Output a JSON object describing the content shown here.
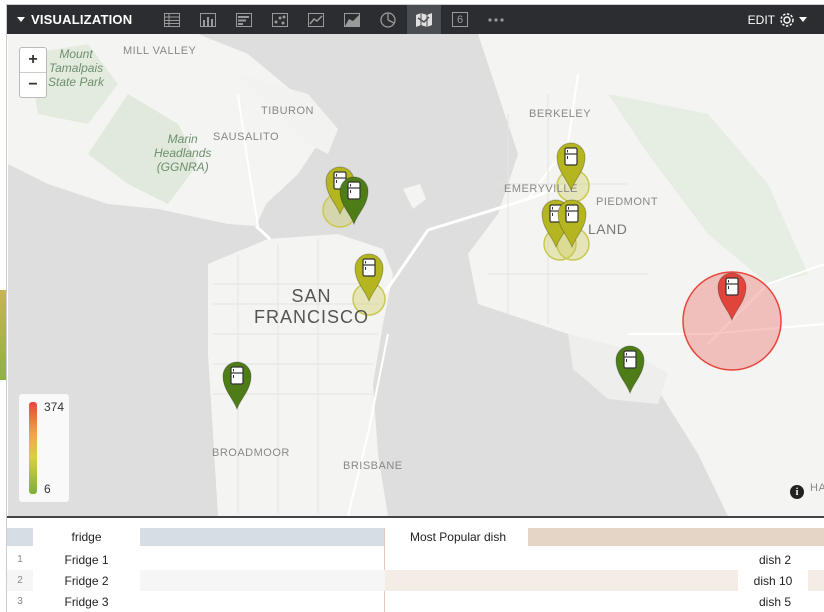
{
  "toolbar": {
    "title": "VISUALIZATION",
    "tabs": [
      {
        "icon": "table-icon"
      },
      {
        "icon": "column-chart-icon"
      },
      {
        "icon": "bar-chart-icon"
      },
      {
        "icon": "scatter-chart-icon"
      },
      {
        "icon": "line-chart-icon"
      },
      {
        "icon": "area-chart-icon"
      },
      {
        "icon": "pie-chart-icon"
      },
      {
        "icon": "map-icon",
        "active": true
      },
      {
        "icon": "single-value-icon",
        "label": "6"
      },
      {
        "icon": "more-icon"
      }
    ],
    "edit_label": "EDIT"
  },
  "map": {
    "zoom_in": "+",
    "zoom_out": "−",
    "labels": {
      "mill_valley": "MILL VALLEY",
      "mount_tamalpais": [
        "Mount",
        "Tamalpais",
        "State Park"
      ],
      "tiburon": "TIBURON",
      "sausalito": "SAUSALITO",
      "marin_headlands": [
        "Marin",
        "Headlands",
        "(GGNRA)"
      ],
      "berkeley": "BERKELEY",
      "emeryville": "EMERYVILLE",
      "piedmont": "PIEDMONT",
      "oakland": "LAND",
      "san_francisco": [
        "SAN",
        "FRANCISCO"
      ],
      "broadmoor": "BROADMOOR",
      "brisbane": "BRISBANE",
      "ha": "HA"
    },
    "legend": {
      "max": "374",
      "min": "6",
      "colors": [
        "#e8453c",
        "#eda64a",
        "#d9d040",
        "#7fae3c"
      ]
    },
    "info_label": "i",
    "markers": [
      {
        "name": "sausalito-marker-1",
        "color": "#b5b520"
      },
      {
        "name": "sausalito-marker-2",
        "color": "#4e7d18"
      },
      {
        "name": "embarcadero-marker",
        "color": "#b5b520"
      },
      {
        "name": "sunset-marker",
        "color": "#4e7d18"
      },
      {
        "name": "emeryville-marker",
        "color": "#b5b520"
      },
      {
        "name": "oakland-marker-1",
        "color": "#b5b520"
      },
      {
        "name": "oakland-marker-2",
        "color": "#b5b520"
      },
      {
        "name": "alameda-marker",
        "color": "#4e7d18"
      },
      {
        "name": "east-oakland-marker",
        "color": "#e0443a"
      }
    ]
  },
  "table": {
    "headers": {
      "fridge": "fridge",
      "dish": "Most Popular dish"
    },
    "rows": [
      {
        "num": "1",
        "fridge": "Fridge 1",
        "dish": "dish 2"
      },
      {
        "num": "2",
        "fridge": "Fridge 2",
        "dish": "dish 10"
      },
      {
        "num": "3",
        "fridge": "Fridge 3",
        "dish": "dish 5"
      }
    ]
  }
}
